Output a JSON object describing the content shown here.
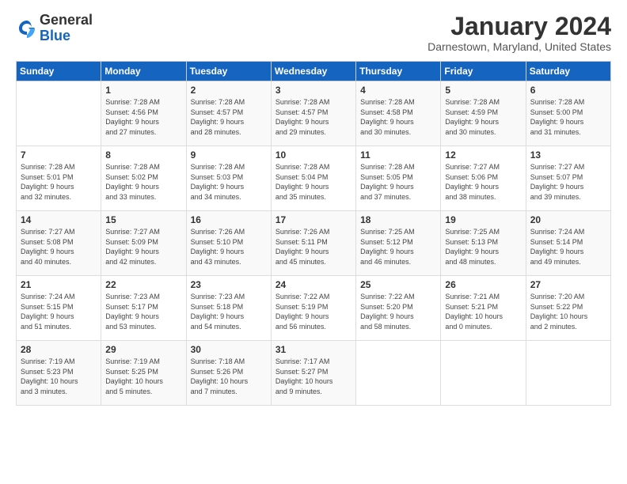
{
  "logo": {
    "general": "General",
    "blue": "Blue"
  },
  "header": {
    "month": "January 2024",
    "location": "Darnestown, Maryland, United States"
  },
  "weekdays": [
    "Sunday",
    "Monday",
    "Tuesday",
    "Wednesday",
    "Thursday",
    "Friday",
    "Saturday"
  ],
  "weeks": [
    [
      {
        "day": "",
        "lines": []
      },
      {
        "day": "1",
        "lines": [
          "Sunrise: 7:28 AM",
          "Sunset: 4:56 PM",
          "Daylight: 9 hours",
          "and 27 minutes."
        ]
      },
      {
        "day": "2",
        "lines": [
          "Sunrise: 7:28 AM",
          "Sunset: 4:57 PM",
          "Daylight: 9 hours",
          "and 28 minutes."
        ]
      },
      {
        "day": "3",
        "lines": [
          "Sunrise: 7:28 AM",
          "Sunset: 4:57 PM",
          "Daylight: 9 hours",
          "and 29 minutes."
        ]
      },
      {
        "day": "4",
        "lines": [
          "Sunrise: 7:28 AM",
          "Sunset: 4:58 PM",
          "Daylight: 9 hours",
          "and 30 minutes."
        ]
      },
      {
        "day": "5",
        "lines": [
          "Sunrise: 7:28 AM",
          "Sunset: 4:59 PM",
          "Daylight: 9 hours",
          "and 30 minutes."
        ]
      },
      {
        "day": "6",
        "lines": [
          "Sunrise: 7:28 AM",
          "Sunset: 5:00 PM",
          "Daylight: 9 hours",
          "and 31 minutes."
        ]
      }
    ],
    [
      {
        "day": "7",
        "lines": [
          "Sunrise: 7:28 AM",
          "Sunset: 5:01 PM",
          "Daylight: 9 hours",
          "and 32 minutes."
        ]
      },
      {
        "day": "8",
        "lines": [
          "Sunrise: 7:28 AM",
          "Sunset: 5:02 PM",
          "Daylight: 9 hours",
          "and 33 minutes."
        ]
      },
      {
        "day": "9",
        "lines": [
          "Sunrise: 7:28 AM",
          "Sunset: 5:03 PM",
          "Daylight: 9 hours",
          "and 34 minutes."
        ]
      },
      {
        "day": "10",
        "lines": [
          "Sunrise: 7:28 AM",
          "Sunset: 5:04 PM",
          "Daylight: 9 hours",
          "and 35 minutes."
        ]
      },
      {
        "day": "11",
        "lines": [
          "Sunrise: 7:28 AM",
          "Sunset: 5:05 PM",
          "Daylight: 9 hours",
          "and 37 minutes."
        ]
      },
      {
        "day": "12",
        "lines": [
          "Sunrise: 7:27 AM",
          "Sunset: 5:06 PM",
          "Daylight: 9 hours",
          "and 38 minutes."
        ]
      },
      {
        "day": "13",
        "lines": [
          "Sunrise: 7:27 AM",
          "Sunset: 5:07 PM",
          "Daylight: 9 hours",
          "and 39 minutes."
        ]
      }
    ],
    [
      {
        "day": "14",
        "lines": [
          "Sunrise: 7:27 AM",
          "Sunset: 5:08 PM",
          "Daylight: 9 hours",
          "and 40 minutes."
        ]
      },
      {
        "day": "15",
        "lines": [
          "Sunrise: 7:27 AM",
          "Sunset: 5:09 PM",
          "Daylight: 9 hours",
          "and 42 minutes."
        ]
      },
      {
        "day": "16",
        "lines": [
          "Sunrise: 7:26 AM",
          "Sunset: 5:10 PM",
          "Daylight: 9 hours",
          "and 43 minutes."
        ]
      },
      {
        "day": "17",
        "lines": [
          "Sunrise: 7:26 AM",
          "Sunset: 5:11 PM",
          "Daylight: 9 hours",
          "and 45 minutes."
        ]
      },
      {
        "day": "18",
        "lines": [
          "Sunrise: 7:25 AM",
          "Sunset: 5:12 PM",
          "Daylight: 9 hours",
          "and 46 minutes."
        ]
      },
      {
        "day": "19",
        "lines": [
          "Sunrise: 7:25 AM",
          "Sunset: 5:13 PM",
          "Daylight: 9 hours",
          "and 48 minutes."
        ]
      },
      {
        "day": "20",
        "lines": [
          "Sunrise: 7:24 AM",
          "Sunset: 5:14 PM",
          "Daylight: 9 hours",
          "and 49 minutes."
        ]
      }
    ],
    [
      {
        "day": "21",
        "lines": [
          "Sunrise: 7:24 AM",
          "Sunset: 5:15 PM",
          "Daylight: 9 hours",
          "and 51 minutes."
        ]
      },
      {
        "day": "22",
        "lines": [
          "Sunrise: 7:23 AM",
          "Sunset: 5:17 PM",
          "Daylight: 9 hours",
          "and 53 minutes."
        ]
      },
      {
        "day": "23",
        "lines": [
          "Sunrise: 7:23 AM",
          "Sunset: 5:18 PM",
          "Daylight: 9 hours",
          "and 54 minutes."
        ]
      },
      {
        "day": "24",
        "lines": [
          "Sunrise: 7:22 AM",
          "Sunset: 5:19 PM",
          "Daylight: 9 hours",
          "and 56 minutes."
        ]
      },
      {
        "day": "25",
        "lines": [
          "Sunrise: 7:22 AM",
          "Sunset: 5:20 PM",
          "Daylight: 9 hours",
          "and 58 minutes."
        ]
      },
      {
        "day": "26",
        "lines": [
          "Sunrise: 7:21 AM",
          "Sunset: 5:21 PM",
          "Daylight: 10 hours",
          "and 0 minutes."
        ]
      },
      {
        "day": "27",
        "lines": [
          "Sunrise: 7:20 AM",
          "Sunset: 5:22 PM",
          "Daylight: 10 hours",
          "and 2 minutes."
        ]
      }
    ],
    [
      {
        "day": "28",
        "lines": [
          "Sunrise: 7:19 AM",
          "Sunset: 5:23 PM",
          "Daylight: 10 hours",
          "and 3 minutes."
        ]
      },
      {
        "day": "29",
        "lines": [
          "Sunrise: 7:19 AM",
          "Sunset: 5:25 PM",
          "Daylight: 10 hours",
          "and 5 minutes."
        ]
      },
      {
        "day": "30",
        "lines": [
          "Sunrise: 7:18 AM",
          "Sunset: 5:26 PM",
          "Daylight: 10 hours",
          "and 7 minutes."
        ]
      },
      {
        "day": "31",
        "lines": [
          "Sunrise: 7:17 AM",
          "Sunset: 5:27 PM",
          "Daylight: 10 hours",
          "and 9 minutes."
        ]
      },
      {
        "day": "",
        "lines": []
      },
      {
        "day": "",
        "lines": []
      },
      {
        "day": "",
        "lines": []
      }
    ]
  ]
}
